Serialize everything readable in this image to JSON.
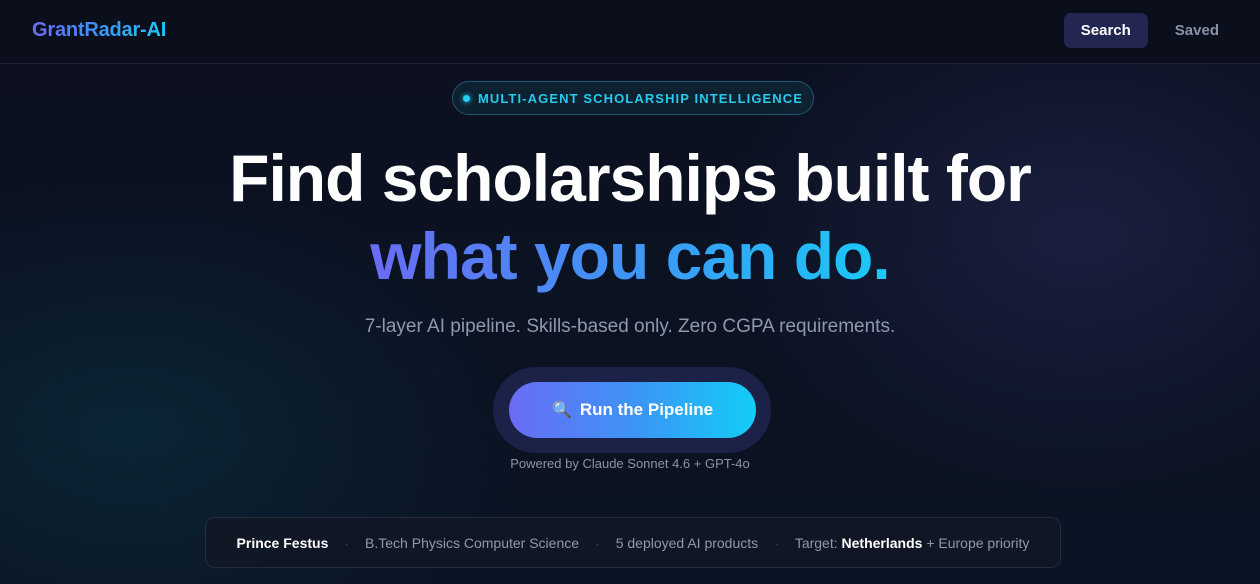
{
  "header": {
    "logo": "GrantRadar-AI",
    "nav": [
      {
        "label": "Search",
        "active": true
      },
      {
        "label": "Saved",
        "active": false
      }
    ]
  },
  "hero": {
    "badge": "MULTI-AGENT SCHOLARSHIP INTELLIGENCE",
    "headline_line1": "Find scholarships built for",
    "headline_line2": "what you can do.",
    "subtitle": "7-layer AI pipeline. Skills-based only. Zero CGPA requirements.",
    "cta_icon": "🔍",
    "cta_label": "Run the Pipeline",
    "powered_by": "Powered by Claude Sonnet 4.6 + GPT-4o"
  },
  "profile": {
    "name": "Prince Festus",
    "degree": "B.Tech Physics Computer Science",
    "products": "5 deployed AI products",
    "target_prefix": "Target:",
    "target_country": "Netherlands",
    "target_suffix": "+ Europe priority",
    "separator": "·"
  },
  "colors": {
    "accent_start": "#6a6cf5",
    "accent_end": "#12cdf7",
    "badge_text": "#27c9ee",
    "background": "#0c1020"
  }
}
